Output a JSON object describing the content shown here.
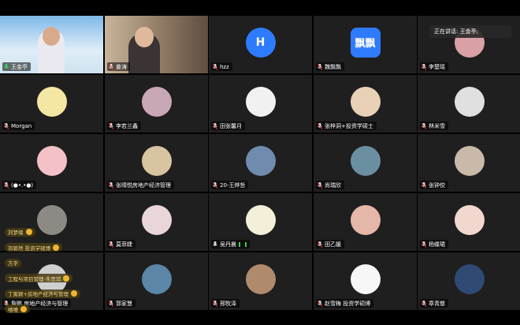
{
  "speaking_label": "正在讲话: 王金亭;",
  "participants": [
    {
      "name": "王金亭",
      "type": "video",
      "mic": "active"
    },
    {
      "name": "姜涛",
      "type": "video",
      "mic": "muted"
    },
    {
      "name": "hzz",
      "type": "letter",
      "letter": "H",
      "color": "#2f7bff",
      "mic": "muted"
    },
    {
      "name": "魏飘飘",
      "type": "letter",
      "letter": "飘飘",
      "color": "#2f7bff",
      "mic": "muted"
    },
    {
      "name": "李楚瑶",
      "type": "avatar",
      "color": "#d9a0a5",
      "mic": "muted"
    },
    {
      "name": "Morgan",
      "type": "avatar",
      "color": "#f3e7a3",
      "mic": "muted"
    },
    {
      "name": "李若兰鑫",
      "type": "avatar",
      "color": "#c8a7b6",
      "mic": "muted"
    },
    {
      "name": "田张馨月",
      "type": "avatar",
      "color": "#f1f1f1",
      "mic": "muted"
    },
    {
      "name": "张梓洞+投资学硕士",
      "type": "avatar",
      "color": "#e8d1b6",
      "mic": "muted"
    },
    {
      "name": "林米雪",
      "type": "avatar",
      "color": "#e0e0e0",
      "mic": "muted"
    },
    {
      "name": "(●•.•●)",
      "type": "avatar",
      "color": "#f3c1c6",
      "mic": "muted"
    },
    {
      "name": "张晴悦房地产经济管理",
      "type": "avatar",
      "color": "#d8c4a1",
      "mic": "muted"
    },
    {
      "name": "20-王烨哲",
      "type": "avatar",
      "color": "#6f8cae",
      "mic": "muted"
    },
    {
      "name": "尚瑞欣",
      "type": "avatar",
      "color": "#6a8fa0",
      "mic": "muted"
    },
    {
      "name": "张钟佼",
      "type": "avatar",
      "color": "#c8b9a8",
      "mic": "muted"
    },
    {
      "name": "",
      "type": "avatar",
      "color": "#8d8a84",
      "mic": "none"
    },
    {
      "name": "莫菲婕",
      "type": "avatar",
      "color": "#e8d6d9",
      "mic": "muted"
    },
    {
      "name": "吴丹晨",
      "type": "avatar",
      "color": "#f4efd9",
      "mic": "speaking"
    },
    {
      "name": "田乙媛",
      "type": "avatar",
      "color": "#e4b7a8",
      "mic": "muted"
    },
    {
      "name": "杨蝶珺",
      "type": "avatar",
      "color": "#f2d7cf",
      "mic": "muted"
    },
    {
      "name": "詹鹏 房地产经济与管理",
      "type": "avatar",
      "color": "#cfcfcf",
      "mic": "muted"
    },
    {
      "name": "郭家慧",
      "type": "avatar",
      "color": "#5b86a7",
      "mic": "muted"
    },
    {
      "name": "邢牧泽",
      "type": "avatar",
      "color": "#b08a6c",
      "mic": "muted"
    },
    {
      "name": "赵雪梅 投资学硕博",
      "type": "avatar",
      "color": "#f7f7f7",
      "mic": "muted"
    },
    {
      "name": "章青慈",
      "type": "avatar",
      "color": "#2f4a73",
      "mic": "muted"
    }
  ],
  "reactions": [
    "刘梦缘",
    "邓郭然 投资学硕博",
    "方字",
    "工程与项目管理-朱思琪",
    "丁寅颖+房地产经济与管理",
    "嘻嘻"
  ]
}
